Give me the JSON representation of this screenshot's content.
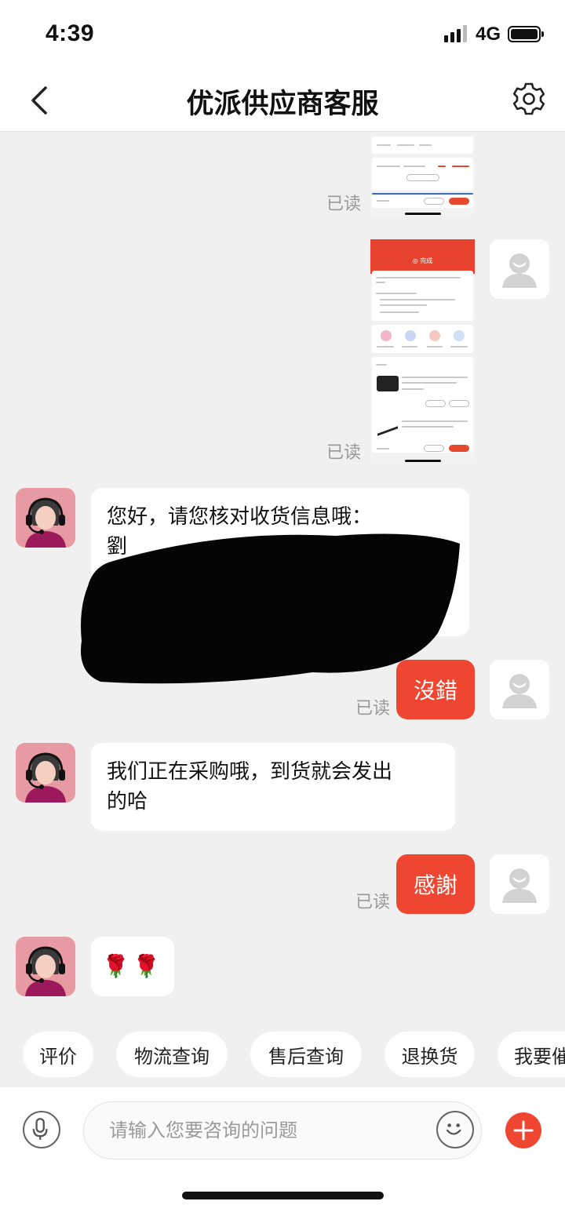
{
  "status_bar": {
    "time": "4:39",
    "network": "4G"
  },
  "header": {
    "title": "优派供应商客服",
    "back_icon": "chevron-left-icon",
    "settings_icon": "gear-icon"
  },
  "messages": {
    "read_label": "已读",
    "agent_1": {
      "lines": [
        "您好，请您核对收货信息哦：",
        "劉"
      ]
    },
    "user_1": "沒錯",
    "agent_2": {
      "lines": [
        "我们正在采购哦，到货就会发出",
        "的哈"
      ]
    },
    "user_2": "感謝",
    "agent_3": "🌹🌹"
  },
  "thumb_2": {
    "header_label": "◎ 完成"
  },
  "quick_chips": [
    "评价",
    "物流查询",
    "售后查询",
    "退换货",
    "我要催"
  ],
  "input": {
    "placeholder": "请输入您要咨询的问题"
  },
  "colors": {
    "accent": "#ef4631",
    "bubble_in": "#ffffff",
    "background": "#f0f0f0",
    "agent_avatar": "#e89aa2"
  }
}
